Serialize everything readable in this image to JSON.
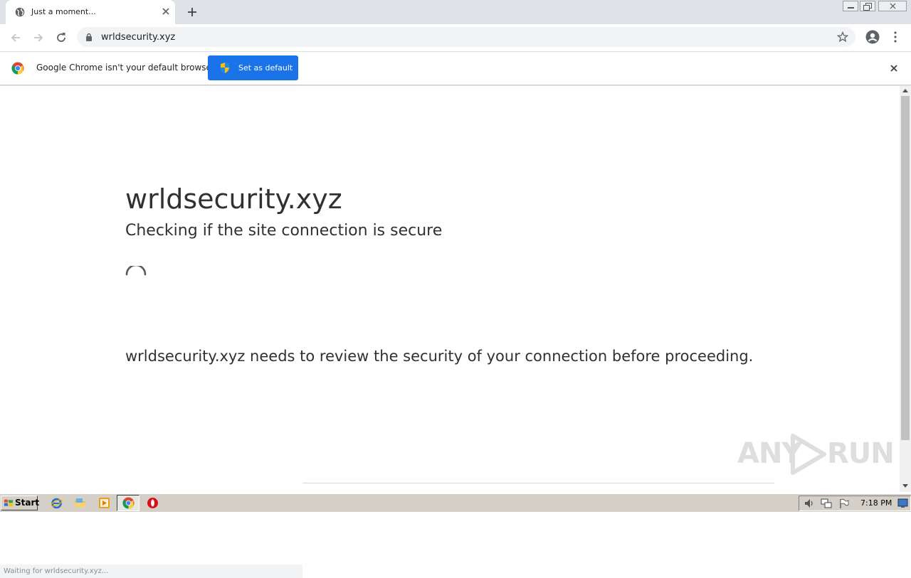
{
  "browser": {
    "tab_title": "Just a moment...",
    "url": "wrldsecurity.xyz"
  },
  "infobar": {
    "message": "Google Chrome isn't your default browser",
    "button_label": "Set as default",
    "button_color": "#1a73e8"
  },
  "page": {
    "heading": "wrldsecurity.xyz",
    "subheading": "Checking if the site connection is secure",
    "body": "wrldsecurity.xyz needs to review the security of your connection before proceeding."
  },
  "status_bar": "Waiting for wrldsecurity.xyz...",
  "watermark": {
    "left": "ANY",
    "right": "RUN"
  },
  "taskbar": {
    "start_label": "Start",
    "clock": "7:18 PM"
  },
  "icons": [
    "globe-icon",
    "close-icon",
    "plus-icon",
    "back-icon",
    "forward-icon",
    "reload-icon",
    "lock-icon",
    "star-icon",
    "profile-icon",
    "menu-icon",
    "chrome-icon",
    "shield-icon",
    "spinner-icon",
    "ie-icon",
    "folder-icon",
    "media-icon",
    "opera-icon",
    "speaker-icon",
    "network-icon",
    "flag-icon"
  ]
}
